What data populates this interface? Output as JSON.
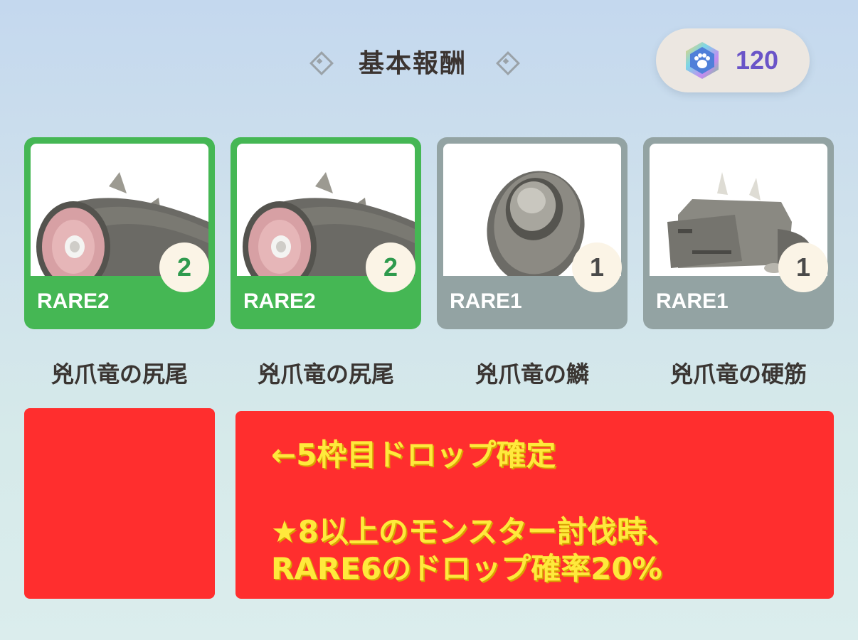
{
  "header": {
    "title": "基本報酬",
    "currency_value": "120",
    "currency_icon": "paw-gem-icon"
  },
  "items": [
    {
      "name": "兇爪竜の尻尾",
      "rarity": "RARE2",
      "quantity": "2",
      "color": "#45b754",
      "icon": "tail-icon"
    },
    {
      "name": "兇爪竜の尻尾",
      "rarity": "RARE2",
      "quantity": "2",
      "color": "#45b754",
      "icon": "tail-icon"
    },
    {
      "name": "兇爪竜の鱗",
      "rarity": "RARE1",
      "quantity": "1",
      "color": "#93a3a3",
      "icon": "scale-icon"
    },
    {
      "name": "兇爪竜の硬筋",
      "rarity": "RARE1",
      "quantity": "1",
      "color": "#93a3a3",
      "icon": "sinew-icon"
    }
  ],
  "overlay": {
    "line1": "←5枠目ドロップ確定",
    "line2": "★8以上のモンスター討伐時、",
    "line3": "RARE6のドロップ確率20%",
    "color": "#ff2e2e",
    "text_color": "#ffe93c"
  }
}
